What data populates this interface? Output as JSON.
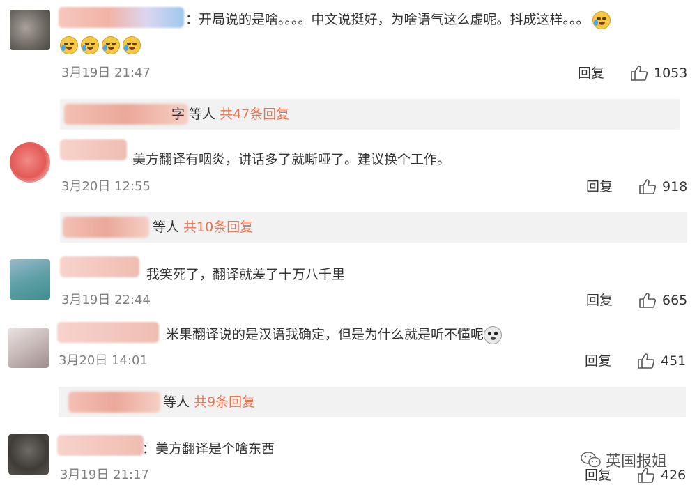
{
  "comments": [
    {
      "text": "：开局说的是啥。。。。中文说挺好，为啥语气这么虚呢。抖成这样。。。",
      "time": "3月19日 21:47",
      "reply_label": "回复",
      "likes": "1053",
      "replies": {
        "suffix": "字 等人 ",
        "count_text": "共47条回复"
      }
    },
    {
      "text": "美方翻译有咽炎，讲话多了就嘶哑了。建议换个工作。",
      "time": "3月20日 12:55",
      "reply_label": "回复",
      "likes": "918",
      "replies": {
        "suffix": "等人 ",
        "count_text": "共10条回复"
      }
    },
    {
      "text": "我笑死了，翻译就差了十万八千里",
      "time": "3月19日 22:44",
      "reply_label": "回复",
      "likes": "665"
    },
    {
      "text": "米果翻译说的是汉语我确定，但是为什么就是听不懂呢",
      "time": "3月20日 14:01",
      "reply_label": "回复",
      "likes": "451",
      "replies": {
        "suffix": "等人 ",
        "count_text": "共9条回复"
      }
    },
    {
      "text": "：美方翻译是个啥东西",
      "time": "3月19日 21:17",
      "reply_label": "回复",
      "likes": "426"
    }
  ],
  "watermark": "英国报姐",
  "icons": {
    "like": "thumbs-up-icon",
    "laugh": "tears-of-joy-emoji",
    "husky": "husky-emoji",
    "wechat": "wechat-icon"
  },
  "colors": {
    "reply_count": "#eb7350",
    "sub_bg": "#f2f2f2",
    "muted": "#808080"
  }
}
